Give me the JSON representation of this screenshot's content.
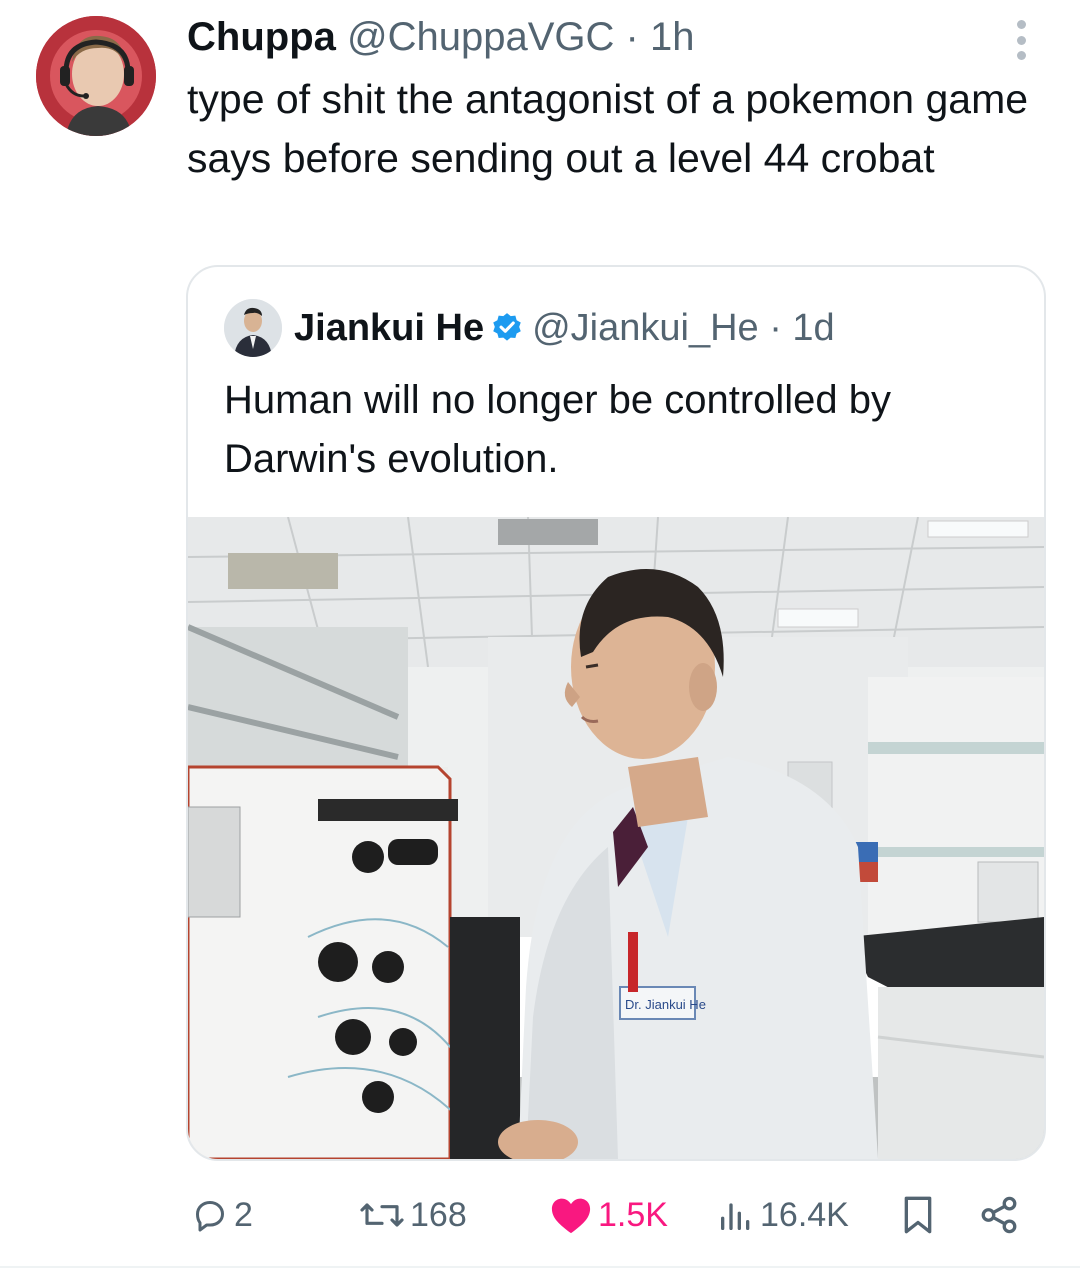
{
  "tweet": {
    "author_name": "Chuppa",
    "author_meta": "@ChuppaVGC · 1h",
    "text": "type of shit the antagonist of a pokemon game says before sending out a level 44 crobat"
  },
  "quoted": {
    "author_name": "Jiankui He",
    "author_meta": "@Jiankui_He · 1d",
    "text": "Human will no longer be controlled by Darwin's evolution.",
    "badge_label": "Dr. Jiankui He"
  },
  "actions": {
    "replies": "2",
    "reposts": "168",
    "likes": "1.5K",
    "views": "16.4K"
  },
  "icons": [
    "more-icon",
    "reply-icon",
    "repost-icon",
    "like-icon",
    "views-icon",
    "bookmark-icon",
    "share-icon",
    "verified-icon"
  ],
  "colors": {
    "like": "#f91880",
    "verified": "#1d9bf0",
    "meta": "#536471"
  }
}
